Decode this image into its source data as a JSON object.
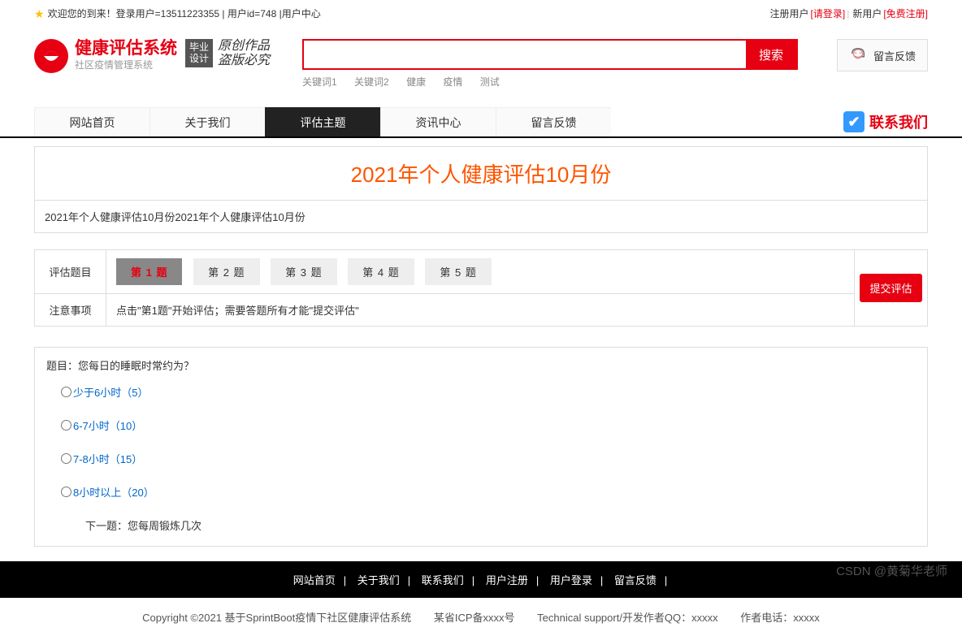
{
  "topbar": {
    "welcome": "欢迎您的到来！登录用户=13511223355 | 用户id=748 | ",
    "user_center": "用户中心",
    "reg_user": "注册用户",
    "please_login": "[请登录]",
    "new_user": "新用户",
    "free_register": "[免费注册]"
  },
  "logo": {
    "title": "健康评估系统",
    "subtitle": "社区疫情管理系统",
    "badge1": "毕业",
    "badge2": "设计",
    "script1": "原创作品",
    "script2": "盗版必究"
  },
  "search": {
    "button": "搜索",
    "keywords": [
      "关键词1",
      "关键词2",
      "健康",
      "疫情",
      "测试"
    ]
  },
  "feedback_btn": "留言反馈",
  "nav": {
    "items": [
      "网站首页",
      "关于我们",
      "评估主题",
      "资讯中心",
      "留言反馈"
    ],
    "active_index": 2,
    "contact": "联系我们"
  },
  "page": {
    "title": "2021年个人健康评估10月份",
    "desc": "2021年个人健康评估10月份2021年个人健康评估10月份"
  },
  "qtabs": {
    "label": "评估题目",
    "tabs": [
      "第 1 题",
      "第 2 题",
      "第 3 题",
      "第 4 题",
      "第 5 题"
    ],
    "active_index": 0,
    "notice_label": "注意事项",
    "notice_text": "点击\"第1题\"开始评估；需要答题所有才能\"提交评估\"",
    "submit": "提交评估"
  },
  "question": {
    "title": "题目：您每日的睡眠时常约为？",
    "options": [
      "少于6小时（5）",
      "6-7小时（10）",
      "7-8小时（15）",
      "8小时以上（20）"
    ],
    "next": "下一题：您每周锻炼几次"
  },
  "footer": {
    "links": [
      "网站首页",
      "关于我们",
      "联系我们",
      "用户注册",
      "用户登录",
      "留言反馈"
    ],
    "copyright": "Copyright ©2021 基于SprintBoot疫情下社区健康评估系统",
    "icp": "某省ICP备xxxx号",
    "tech": "Technical support/开发作者QQ：xxxxx",
    "author": "作者电话：xxxxx"
  },
  "watermark": "CSDN @黄菊华老师"
}
